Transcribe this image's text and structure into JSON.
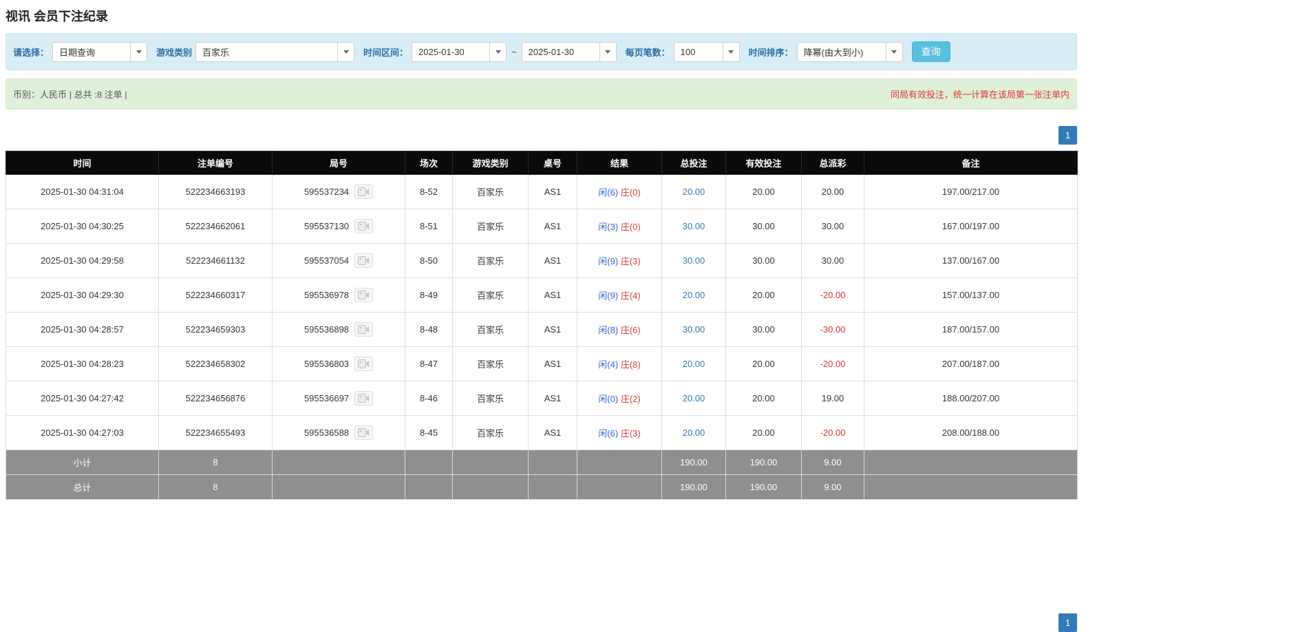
{
  "page_title": "视讯 会员下注纪录",
  "filter": {
    "select_label": "请选择：",
    "select_value": "日期查询",
    "game_label": "游戏类别",
    "game_value": "百家乐",
    "time_label": "时间区间：",
    "time_from": "2025-01-30",
    "tilde": "~",
    "time_to": "2025-01-30",
    "per_page_label": "每页笔数：",
    "per_page_value": "100",
    "sort_label": "时间排序：",
    "sort_value": "降幂(由大到小)",
    "query_button": "查询"
  },
  "info_bar": {
    "left": "币别：人民币 | 总共 :8 注单 |",
    "right": "同局有效投注，统一计算在该局第一张注单内"
  },
  "pagination": {
    "page": "1"
  },
  "colors": {
    "accent_blue": "#337ab7",
    "negative_red": "#e03333",
    "player_blue": "#3366cc",
    "banker_red": "#d43f3a",
    "filter_bg": "#d9edf7",
    "info_bg": "#dff0d8",
    "header_bg": "#0a0a0a",
    "footer_bg": "#8f8f8f"
  },
  "table": {
    "headers": [
      "时间",
      "注单编号",
      "局号",
      "场次",
      "游戏类别",
      "桌号",
      "结果",
      "总投注",
      "有效投注",
      "总派彩",
      "备注"
    ],
    "rows": [
      {
        "time": "2025-01-30 04:31:04",
        "bet_id": "522234663193",
        "round_no": "595537234",
        "session": "8-52",
        "game": "百家乐",
        "table_no": "AS1",
        "player": "闲(6)",
        "banker": "庄(0)",
        "total_bet": "20.00",
        "valid_bet": "20.00",
        "payout": "20.00",
        "remark": "197.00/217.00"
      },
      {
        "time": "2025-01-30 04:30:25",
        "bet_id": "522234662061",
        "round_no": "595537130",
        "session": "8-51",
        "game": "百家乐",
        "table_no": "AS1",
        "player": "闲(3)",
        "banker": "庄(0)",
        "total_bet": "30.00",
        "valid_bet": "30.00",
        "payout": "30.00",
        "remark": "167.00/197.00"
      },
      {
        "time": "2025-01-30 04:29:58",
        "bet_id": "522234661132",
        "round_no": "595537054",
        "session": "8-50",
        "game": "百家乐",
        "table_no": "AS1",
        "player": "闲(9)",
        "banker": "庄(3)",
        "total_bet": "30.00",
        "valid_bet": "30.00",
        "payout": "30.00",
        "remark": "137.00/167.00"
      },
      {
        "time": "2025-01-30 04:29:30",
        "bet_id": "522234660317",
        "round_no": "595536978",
        "session": "8-49",
        "game": "百家乐",
        "table_no": "AS1",
        "player": "闲(9)",
        "banker": "庄(4)",
        "total_bet": "20.00",
        "valid_bet": "20.00",
        "payout": "-20.00",
        "remark": "157.00/137.00"
      },
      {
        "time": "2025-01-30 04:28:57",
        "bet_id": "522234659303",
        "round_no": "595536898",
        "session": "8-48",
        "game": "百家乐",
        "table_no": "AS1",
        "player": "闲(8)",
        "banker": "庄(6)",
        "total_bet": "30.00",
        "valid_bet": "30.00",
        "payout": "-30.00",
        "remark": "187.00/157.00"
      },
      {
        "time": "2025-01-30 04:28:23",
        "bet_id": "522234658302",
        "round_no": "595536803",
        "session": "8-47",
        "game": "百家乐",
        "table_no": "AS1",
        "player": "闲(4)",
        "banker": "庄(8)",
        "total_bet": "20.00",
        "valid_bet": "20.00",
        "payout": "-20.00",
        "remark": "207.00/187.00"
      },
      {
        "time": "2025-01-30 04:27:42",
        "bet_id": "522234656876",
        "round_no": "595536697",
        "session": "8-46",
        "game": "百家乐",
        "table_no": "AS1",
        "player": "闲(0)",
        "banker": "庄(2)",
        "total_bet": "20.00",
        "valid_bet": "20.00",
        "payout": "19.00",
        "remark": "188.00/207.00"
      },
      {
        "time": "2025-01-30 04:27:03",
        "bet_id": "522234655493",
        "round_no": "595536588",
        "session": "8-45",
        "game": "百家乐",
        "table_no": "AS1",
        "player": "闲(6)",
        "banker": "庄(3)",
        "total_bet": "20.00",
        "valid_bet": "20.00",
        "payout": "-20.00",
        "remark": "208.00/188.00"
      }
    ],
    "subtotal": {
      "label": "小计",
      "count": "8",
      "total_bet": "190.00",
      "valid_bet": "190.00",
      "payout": "9.00"
    },
    "total": {
      "label": "总计",
      "count": "8",
      "total_bet": "190.00",
      "valid_bet": "190.00",
      "payout": "9.00"
    }
  }
}
